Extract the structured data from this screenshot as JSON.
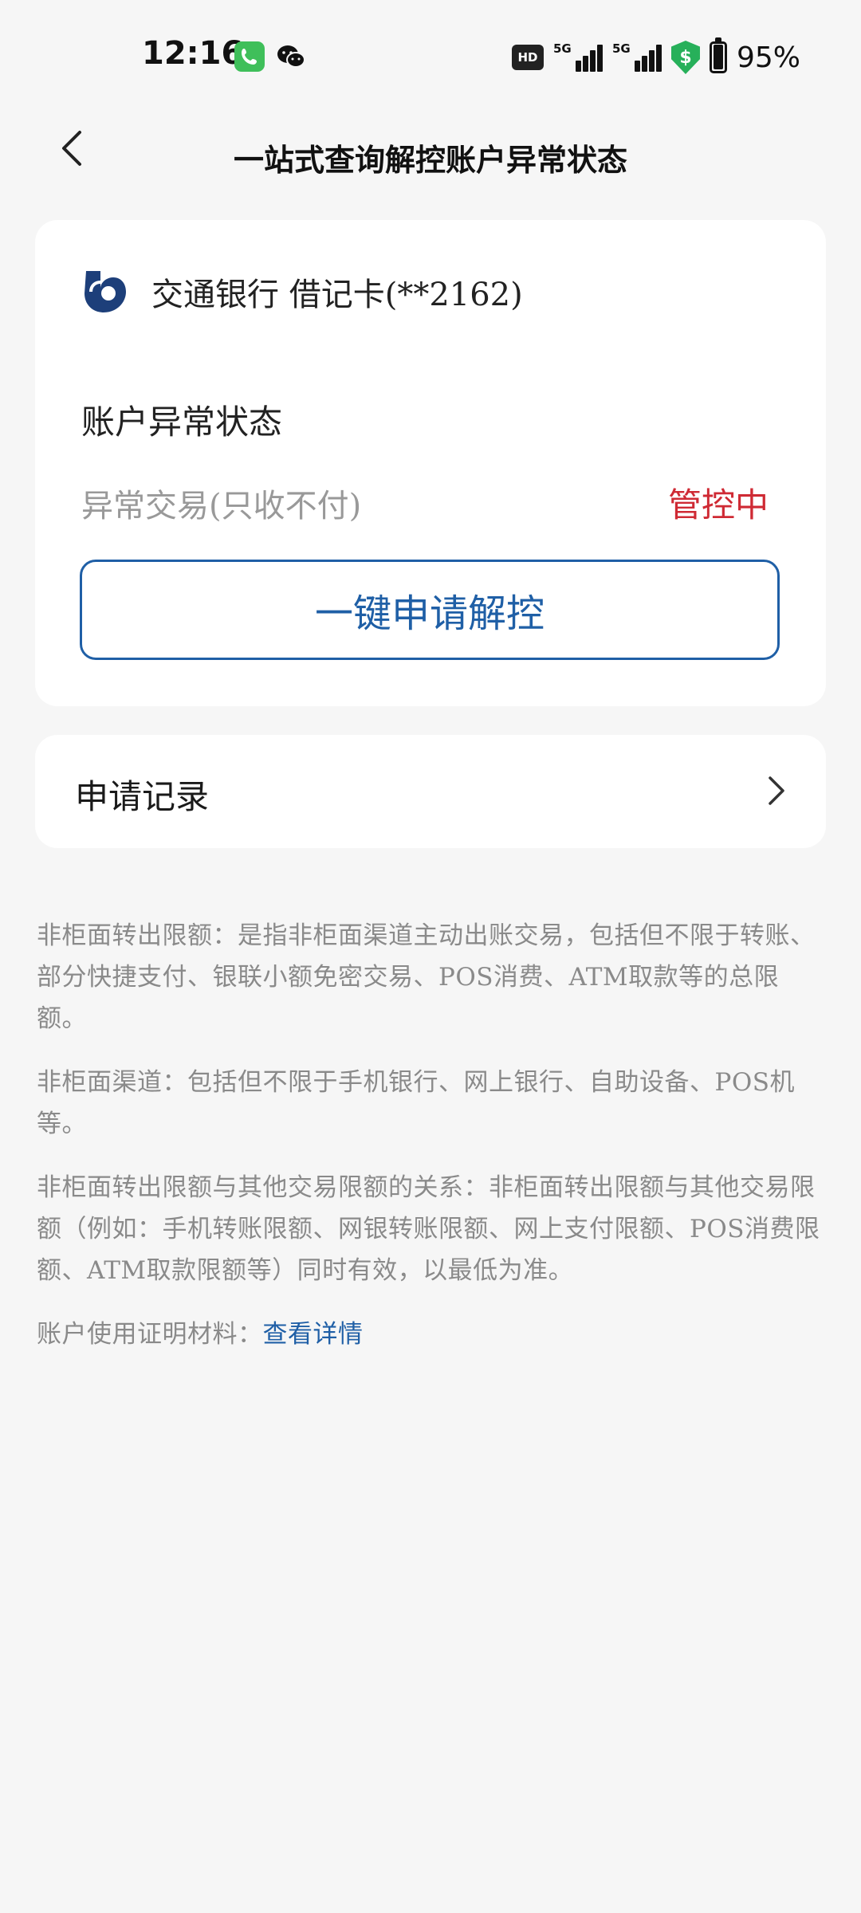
{
  "status_bar": {
    "time": "12:16",
    "network_1": "5G",
    "network_2": "5G",
    "hd_badge": "HD",
    "battery": "95%",
    "shield_symbol": "$"
  },
  "nav": {
    "title": "一站式查询解控账户异常状态",
    "back_icon": "chevron-left-icon"
  },
  "account_card": {
    "bank_name": "交通银行 借记卡(**2162)",
    "section_title": "账户异常状态",
    "abnormal_label": "异常交易(只收不付)",
    "abnormal_status": "管控中",
    "unlock_button": "一键申请解控",
    "colors": {
      "accent": "#1f5fa6",
      "status_red": "#cf2a34"
    }
  },
  "records": {
    "label": "申请记录",
    "arrow_icon": "chevron-right-icon"
  },
  "notes": {
    "note1": "非柜面转出限额：是指非柜面渠道主动出账交易，包括但不限于转账、部分快捷支付、银联小额免密交易、POS消费、ATM取款等的总限额。",
    "note2": "非柜面渠道：包括但不限于手机银行、网上银行、自助设备、POS机等。",
    "note3": "非柜面转出限额与其他交易限额的关系：非柜面转出限额与其他交易限额（例如：手机转账限额、网银转账限额、网上支付限额、POS消费限额、ATM取款限额等）同时有效，以最低为准。",
    "note4_prefix": "账户使用证明材料：",
    "note4_link": "查看详情"
  }
}
